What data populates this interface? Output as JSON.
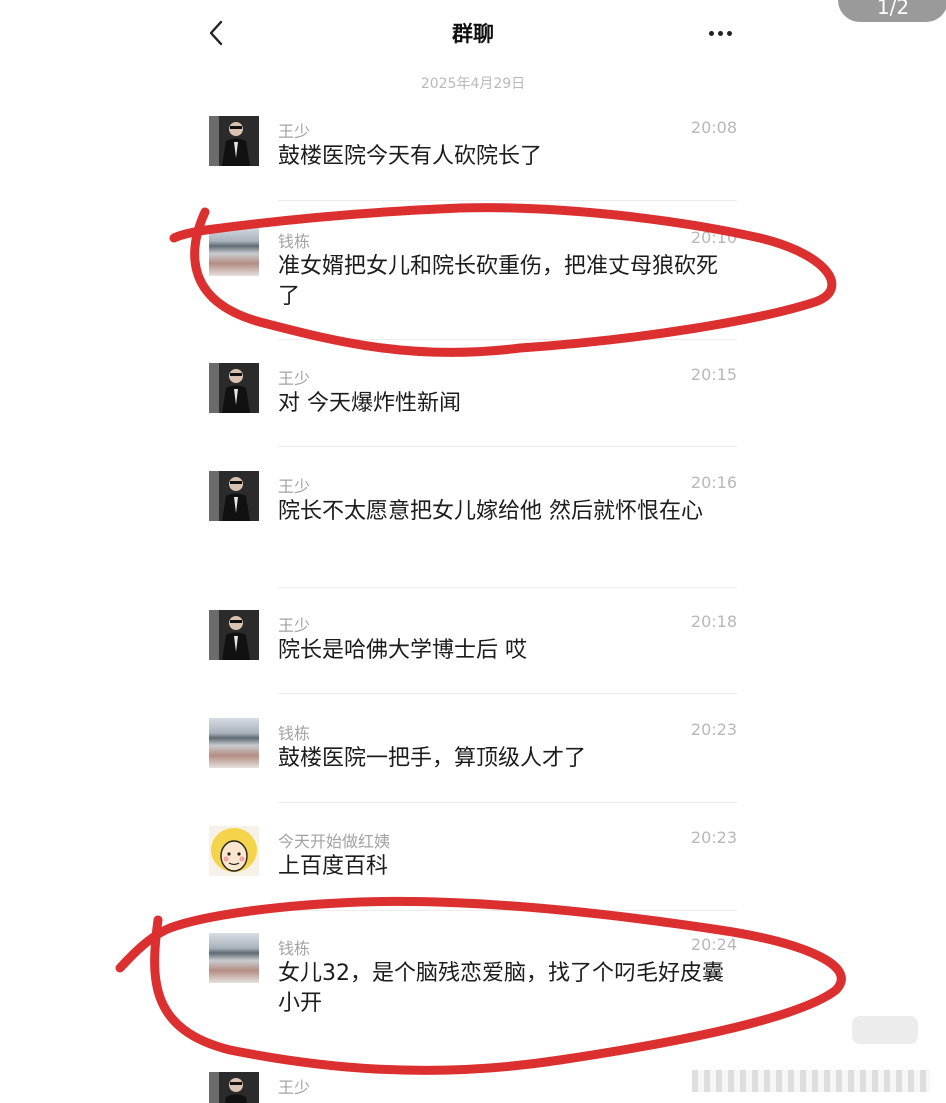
{
  "header": {
    "title": "群聊",
    "page_indicator": "1/2"
  },
  "date_label": "2025年4月29日",
  "messages": [
    {
      "sender": "王少",
      "time": "20:08",
      "text": "鼓楼医院今天有人砍院长了"
    },
    {
      "sender": "钱栋",
      "time": "20:10",
      "text": "准女婿把女儿和院长砍重伤，把准丈母狼砍死了"
    },
    {
      "sender": "王少",
      "time": "20:15",
      "text": "对 今天爆炸性新闻"
    },
    {
      "sender": "王少",
      "time": "20:16",
      "text": "院长不太愿意把女儿嫁给他 然后就怀恨在心"
    },
    {
      "sender": "王少",
      "time": "20:18",
      "text": "院长是哈佛大学博士后 哎"
    },
    {
      "sender": "钱栋",
      "time": "20:23",
      "text": "鼓楼医院一把手，算顶级人才了"
    },
    {
      "sender": "今天开始做红姨",
      "time": "20:23",
      "text": "上百度百科"
    },
    {
      "sender": "钱栋",
      "time": "20:24",
      "text": "女儿32，是个脑残恋爱脑，找了个叼毛好皮囊小开"
    },
    {
      "sender": "王少",
      "time": "",
      "text": ""
    }
  ],
  "icons": {
    "back": "chevron-left-icon",
    "more": "more-horizontal-icon"
  },
  "colors": {
    "annotation": "#d92b2b",
    "timestamp": "#b8b8b8",
    "sender": "#a3a3a3"
  }
}
